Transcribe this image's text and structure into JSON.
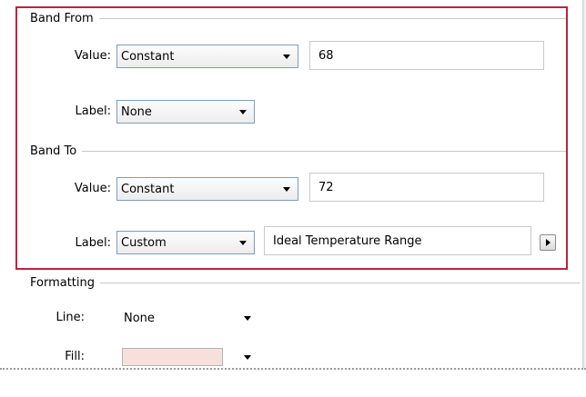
{
  "band_from": {
    "header": "Band From",
    "value_label": "Value:",
    "value_type": "Constant",
    "value": "68",
    "label_label": "Label:",
    "label_type": "None"
  },
  "band_to": {
    "header": "Band To",
    "value_label": "Value:",
    "value_type": "Constant",
    "value": "72",
    "label_label": "Label:",
    "label_type": "Custom",
    "custom_label": "Ideal Temperature Range"
  },
  "formatting": {
    "header": "Formatting",
    "line_label": "Line:",
    "line_value": "None",
    "fill_label": "Fill:",
    "fill_color": "#f5e0dc"
  },
  "colors": {
    "highlight_border": "#c0223f"
  },
  "icons": {
    "insert_arrow": "right-triangle-icon"
  }
}
